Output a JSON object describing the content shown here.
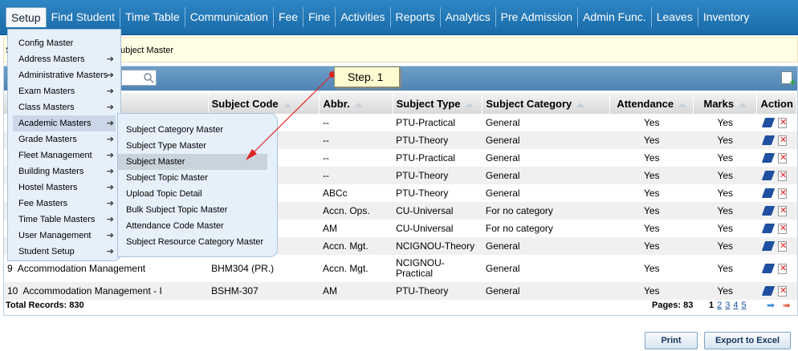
{
  "nav": [
    "Setup",
    "Find Student",
    "Time Table",
    "Communication",
    "Fee",
    "Fine",
    "Activities",
    "Reports",
    "Analytics",
    "Pre Admission",
    "Admin Func.",
    "Leaves",
    "Inventory"
  ],
  "breadcrumb": {
    "left": "S",
    "current": "ubject Master"
  },
  "setup_menu": [
    {
      "label": "Config Master",
      "sub": false
    },
    {
      "label": "Address Masters",
      "sub": true
    },
    {
      "label": "Administrative Masters",
      "sub": true
    },
    {
      "label": "Exam Masters",
      "sub": true
    },
    {
      "label": "Class Masters",
      "sub": true
    },
    {
      "label": "Academic Masters",
      "sub": true
    },
    {
      "label": "Grade Masters",
      "sub": true
    },
    {
      "label": "Fleet Management",
      "sub": true
    },
    {
      "label": "Building Masters",
      "sub": true
    },
    {
      "label": "Hostel Masters",
      "sub": true
    },
    {
      "label": "Fee Masters",
      "sub": true
    },
    {
      "label": "Time Table Masters",
      "sub": true
    },
    {
      "label": "User Management",
      "sub": true
    },
    {
      "label": "Student Setup",
      "sub": true
    }
  ],
  "academic_menu": [
    "Subject Category Master",
    "Subject Type Master",
    "Subject Master",
    "Subject Topic Master",
    "Upload Topic Detail",
    "Bulk Subject Topic Master",
    "Attendance Code Master",
    "Subject Resource Category Master"
  ],
  "step_label": "Step. 1",
  "columns": [
    "Subject Code",
    "Abbr.",
    "Subject Type",
    "Subject Category",
    "Attendance",
    "Marks",
    "Action"
  ],
  "rows": [
    {
      "no": "",
      "name": "",
      "code": "",
      "abbr": "--",
      "type": "PTU-Practical",
      "cat": "General",
      "att": "Yes",
      "marks": "Yes"
    },
    {
      "no": "",
      "name": "",
      "code": "",
      "abbr": "--",
      "type": "PTU-Theory",
      "cat": "General",
      "att": "Yes",
      "marks": "Yes"
    },
    {
      "no": "",
      "name": "",
      "code": "",
      "abbr": "--",
      "type": "PTU-Practical",
      "cat": "General",
      "att": "Yes",
      "marks": "Yes"
    },
    {
      "no": "",
      "name": "",
      "code": "",
      "abbr": "--",
      "type": "PTU-Theory",
      "cat": "General",
      "att": "Yes",
      "marks": "Yes"
    },
    {
      "no": "",
      "name": "",
      "code": "",
      "abbr": "ABCc",
      "type": "PTU-Theory",
      "cat": "General",
      "att": "Yes",
      "marks": "Yes"
    },
    {
      "no": "",
      "name": "",
      "code": "",
      "abbr": "Accn. Ops.",
      "type": "CU-Universal",
      "cat": "For no category",
      "att": "Yes",
      "marks": "Yes"
    },
    {
      "no": "",
      "name": "",
      "code": "",
      "abbr": "AM",
      "type": "CU-Universal",
      "cat": "For no category",
      "att": "Yes",
      "marks": "Yes"
    },
    {
      "no": "",
      "name": "",
      "code": "",
      "abbr": "Accn. Mgt.",
      "type": "NCIGNOU-Theory",
      "cat": "General",
      "att": "Yes",
      "marks": "Yes"
    },
    {
      "no": "9",
      "name": "Accommodation Management",
      "code": "BHM304 (PR.)",
      "abbr": "Accn. Mgt.",
      "type": "NCIGNOU-Practical",
      "cat": "General",
      "att": "Yes",
      "marks": "Yes"
    },
    {
      "no": "10",
      "name": "Accommodation Management - I",
      "code": "BSHM-307",
      "abbr": "AM",
      "type": "PTU-Theory",
      "cat": "General",
      "att": "Yes",
      "marks": "Yes"
    }
  ],
  "footer": {
    "total_label": "Total Records:",
    "total": "830",
    "pages_label": "Pages:",
    "pages": "83",
    "page_links": [
      "1",
      "2",
      "3",
      "4",
      "5"
    ]
  },
  "buttons": {
    "print": "Print",
    "export": "Export to Excel"
  }
}
